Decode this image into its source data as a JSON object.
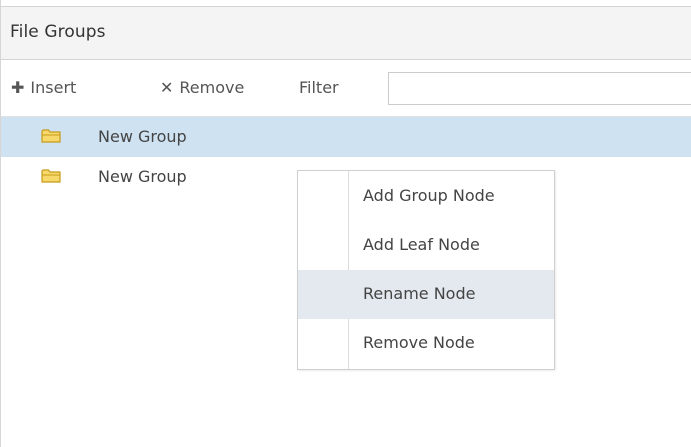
{
  "header": {
    "title": "File Groups"
  },
  "toolbar": {
    "insert_label": "Insert",
    "insert_icon": "plus-icon",
    "remove_label": "Remove",
    "remove_icon": "close-icon",
    "filter_label": "Filter",
    "filter_value": "",
    "filter_placeholder": ""
  },
  "tree": {
    "nodes": [
      {
        "label": "New Group",
        "icon": "folder-icon",
        "selected": true
      },
      {
        "label": "New Group",
        "icon": "folder-icon",
        "selected": false
      }
    ]
  },
  "context_menu": {
    "items": [
      {
        "label": "Add Group Node"
      },
      {
        "label": "Add Leaf Node"
      },
      {
        "label": "Rename Node",
        "hovered": true
      },
      {
        "label": "Remove Node"
      }
    ]
  },
  "colors": {
    "selection": "#cfe2f1",
    "menu_hover": "#e3e9ee",
    "folder_fill": "#f6d86b",
    "folder_stroke": "#c59b1b"
  }
}
